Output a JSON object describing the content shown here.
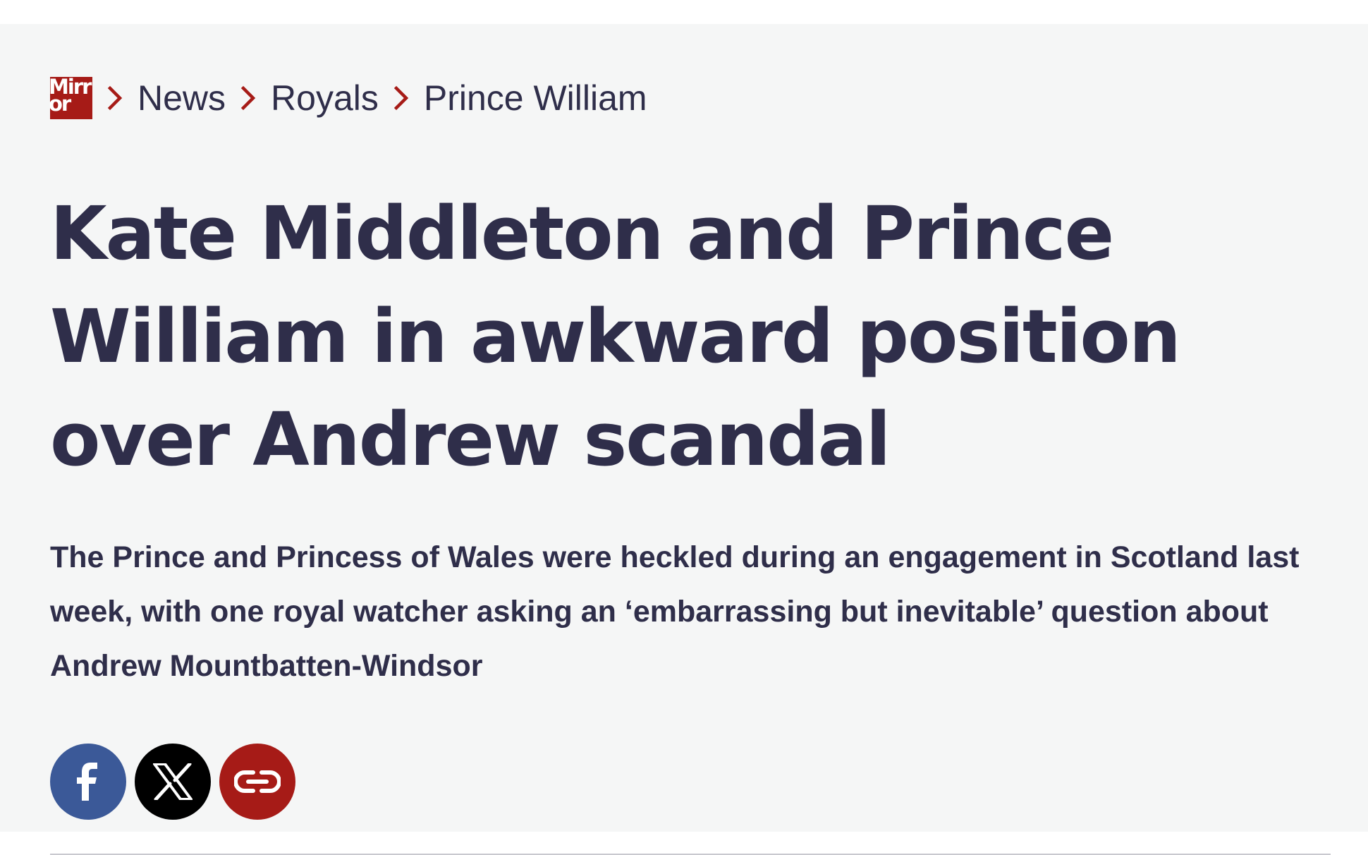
{
  "colors": {
    "page_background": "#f5f6f6",
    "text": "#2f2e4a",
    "brand_red": "#a61b17",
    "facebook": "#3b5998",
    "x": "#000000",
    "copy_link": "#a61b17"
  },
  "breadcrumb": {
    "logo_text_line1": "Mirr",
    "logo_text_line2": "or",
    "separator_icon": "chevron-right-icon",
    "items": [
      {
        "label": "News"
      },
      {
        "label": "Royals"
      },
      {
        "label": "Prince William"
      }
    ]
  },
  "article": {
    "headline": "Kate Middleton and Prince William in awkward position over Andrew scandal",
    "standfirst": "The Prince and Princess of Wales were heckled during an engagement in Scotland last week, with one royal watcher asking an ‘embarrassing but inevitable’ question about Andrew Mountbatten-Windsor"
  },
  "share": {
    "buttons": [
      {
        "icon": "facebook-icon",
        "color": "#3b5998"
      },
      {
        "icon": "x-icon",
        "color": "#000000"
      },
      {
        "icon": "link-icon",
        "color": "#a61b17"
      }
    ]
  }
}
